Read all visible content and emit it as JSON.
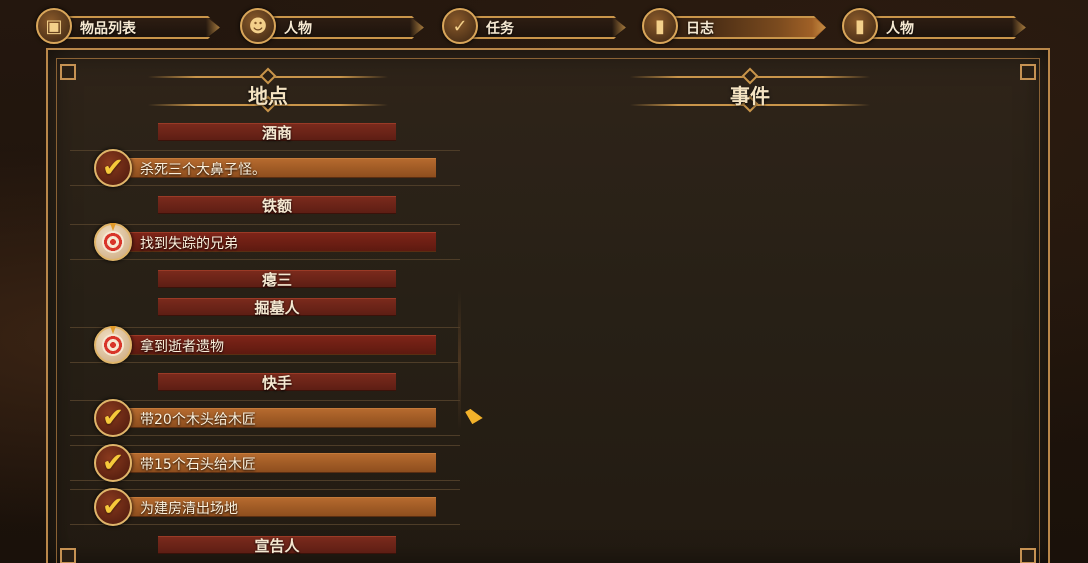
{
  "tabs": [
    {
      "label": "物品列表",
      "icon": "bag-icon"
    },
    {
      "label": "人物",
      "icon": "character-portrait-icon"
    },
    {
      "label": "任务",
      "icon": "quest-scroll-icon"
    },
    {
      "label": "日志",
      "icon": "journal-book-icon",
      "active": true
    },
    {
      "label": "人物",
      "icon": "character-book-icon"
    }
  ],
  "columns": {
    "location": "地点",
    "event": "事件"
  },
  "locations": [
    {
      "name": "酒商",
      "quests": [
        {
          "text": "杀死三个大鼻子怪。",
          "status": "completed"
        }
      ]
    },
    {
      "name": "铁额",
      "quests": [
        {
          "text": "找到失踪的兄弟",
          "status": "active"
        }
      ]
    },
    {
      "name": "瘪三",
      "quests": []
    },
    {
      "name": "掘墓人",
      "quests": [
        {
          "text": "拿到逝者遗物",
          "status": "active"
        }
      ]
    },
    {
      "name": "快手",
      "quests": [
        {
          "text": "带20个木头给木匠",
          "status": "completed"
        },
        {
          "text": "带15个石头给木匠",
          "status": "completed"
        },
        {
          "text": "为建房清出场地",
          "status": "completed"
        }
      ]
    },
    {
      "name": "宣告人",
      "quests": []
    }
  ],
  "colors": {
    "frame": "#c9954a",
    "completed_bar": "#b56a2e",
    "active_bar": "#7e2418",
    "location_bar": "#6e2418"
  }
}
